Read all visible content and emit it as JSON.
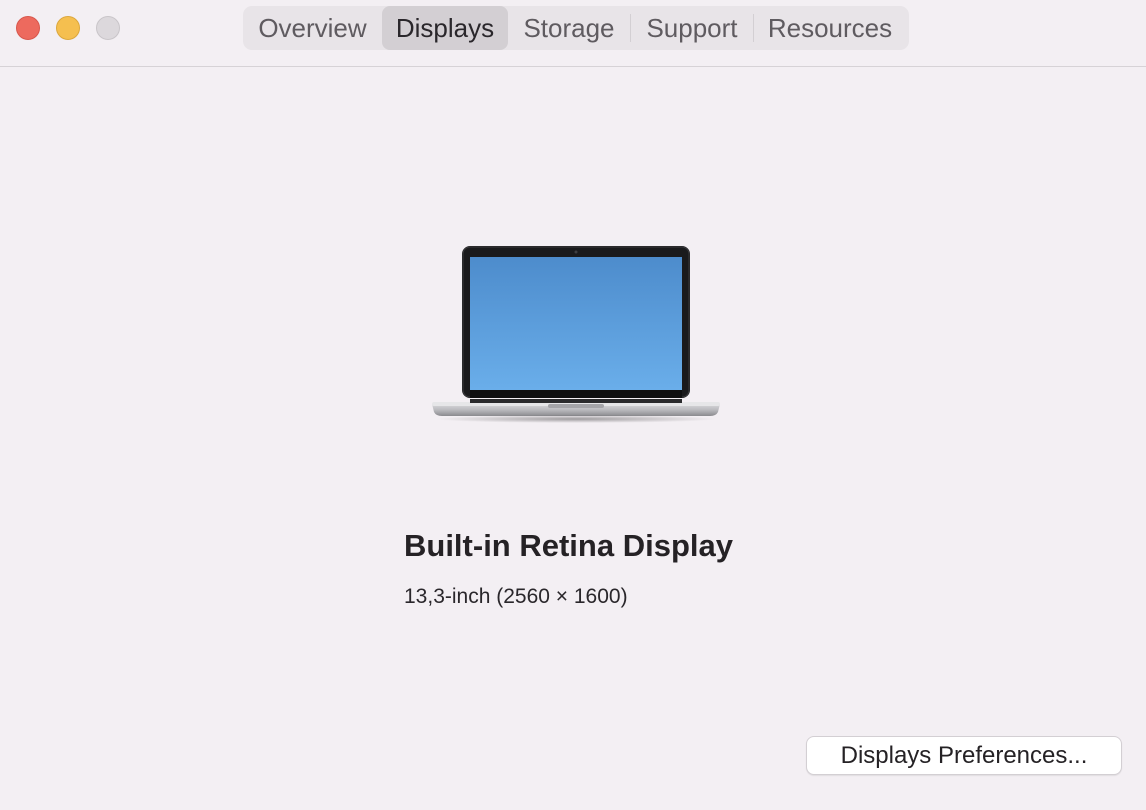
{
  "window": {
    "controls": [
      "close",
      "minimize",
      "zoom"
    ]
  },
  "tabs": [
    {
      "label": "Overview"
    },
    {
      "label": "Displays"
    },
    {
      "label": "Storage"
    },
    {
      "label": "Support"
    },
    {
      "label": "Resources"
    }
  ],
  "active_tab": "Displays",
  "display": {
    "image_icon": "macbook-pro-icon",
    "name": "Built-in Retina Display",
    "spec": "13,3-inch (2560 × 1600)"
  },
  "buttons": {
    "preferences_label": "Displays Preferences..."
  },
  "colors": {
    "background": "#f3eff3",
    "close": "#ed6a5e",
    "minimize": "#f5bf4f",
    "zoom_inactive": "#dcd8dc",
    "segment_active": "#d3cfd3",
    "screen_top": "#4d8ccc",
    "screen_bottom": "#6aaeea"
  }
}
